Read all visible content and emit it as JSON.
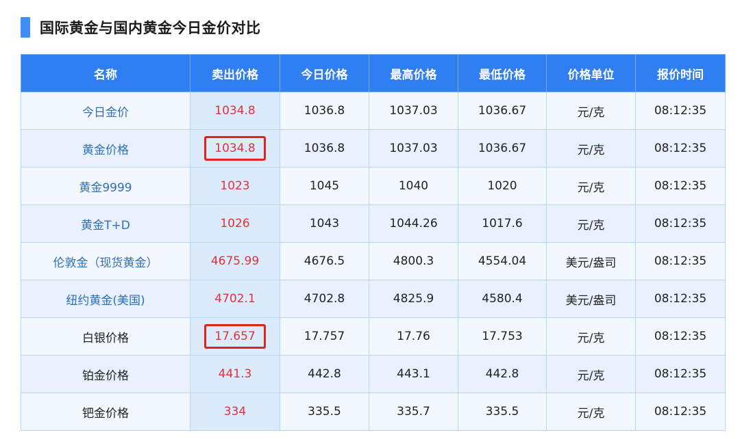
{
  "page": {
    "title": "国际黄金与国内黄金今日金价对比"
  },
  "table": {
    "headers": [
      "名称",
      "卖出价格",
      "今日价格",
      "最高价格",
      "最低价格",
      "价格单位",
      "报价时间"
    ],
    "rows": [
      [
        "今日金价",
        "1034.8",
        "1036.8",
        "1037.03",
        "1036.67",
        "元/克",
        "08:12:35"
      ],
      [
        "黄金价格",
        "1034.8",
        "1036.8",
        "1037.03",
        "1036.67",
        "元/克",
        "08:12:35"
      ],
      [
        "黄金9999",
        "1023",
        "1045",
        "1040",
        "1020",
        "元/克",
        "08:12:35"
      ],
      [
        "黄金T+D",
        "1026",
        "1043",
        "1044.26",
        "1017.6",
        "元/克",
        "08:12:35"
      ],
      [
        "伦敦金（现货黄金）",
        "4675.99",
        "4676.5",
        "4800.3",
        "4554.04",
        "美元/盎司",
        "08:12:35"
      ],
      [
        "纽约黄金(美国)",
        "4702.1",
        "4702.8",
        "4825.9",
        "4580.4",
        "美元/盎司",
        "08:12:35"
      ],
      [
        "白银价格",
        "17.657",
        "17.757",
        "17.76",
        "17.753",
        "元/克",
        "08:12:35"
      ],
      [
        "铂金价格",
        "441.3",
        "442.8",
        "443.1",
        "442.8",
        "元/克",
        "08:12:35"
      ],
      [
        "钯金价格",
        "334",
        "335.5",
        "335.7",
        "335.5",
        "元/克",
        "08:12:35"
      ]
    ]
  },
  "colors": {
    "header_bg": "#2f7ff3",
    "accent_bar": "#3d8ef5",
    "sell_price": "#e5303a",
    "name_text": "#2f6fb8",
    "highlight_box": "#e2231a"
  }
}
